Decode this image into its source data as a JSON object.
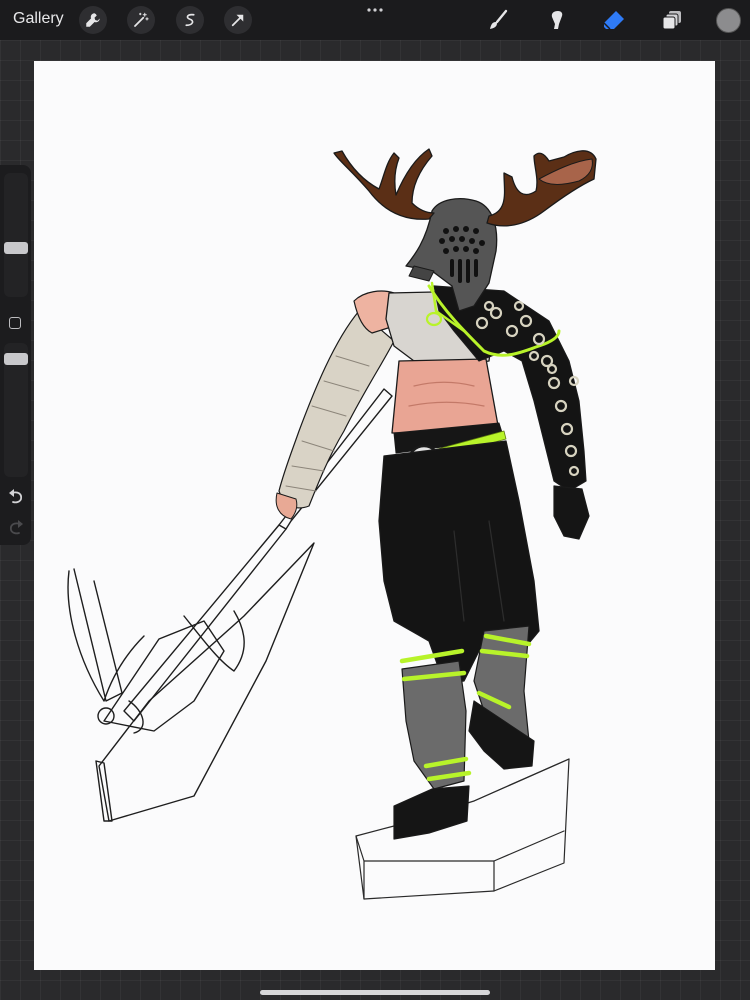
{
  "app": {
    "gallery_label": "Gallery"
  },
  "toolbar": {
    "left_tools": [
      "actions-wrench-icon",
      "adjustments-magic-wand-icon",
      "selection-icon",
      "transform-arrow-icon"
    ],
    "right_tools": [
      "brush-icon",
      "smudge-icon",
      "eraser-icon",
      "layers-icon"
    ],
    "active_tool": "eraser",
    "accent_color": "#2f7bf6",
    "current_color": "#8c8c8e"
  },
  "sidebar": {
    "brush_size_level": 0.38,
    "opacity_level": 0.92
  }
}
